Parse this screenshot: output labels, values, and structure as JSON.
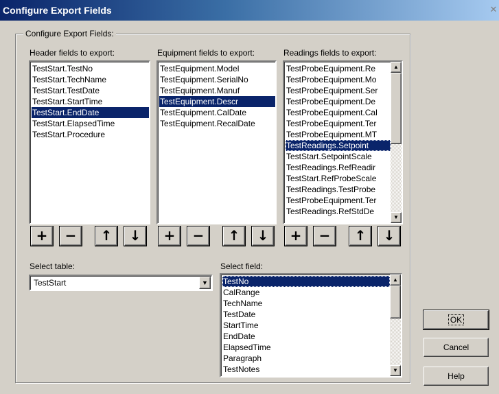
{
  "window": {
    "title": "Configure Export Fields",
    "close_glyph": "✕"
  },
  "group": {
    "label": "Configure Export Fields:"
  },
  "header_fields": {
    "label": "Header fields to export:",
    "items": [
      "TestStart.TestNo",
      "TestStart.TechName",
      "TestStart.TestDate",
      "TestStart.StartTime",
      "TestStart.EndDate",
      "TestStart.ElapsedTime",
      "TestStart.Procedure"
    ],
    "selected_index": 4
  },
  "equipment_fields": {
    "label": "Equipment fields to export:",
    "items": [
      "TestEquipment.Model",
      "TestEquipment.SerialNo",
      "TestEquipment.Manuf",
      "TestEquipment.Descr",
      "TestEquipment.CalDate",
      "TestEquipment.RecalDate"
    ],
    "selected_index": 3
  },
  "readings_fields": {
    "label": "Readings fields to export:",
    "items": [
      "TestProbeEquipment.Re",
      "TestProbeEquipment.Mo",
      "TestProbeEquipment.Ser",
      "TestProbeEquipment.De",
      "TestProbeEquipment.Cal",
      "TestProbeEquipment.Ter",
      "TestProbeEquipment.MT",
      "TestReadings.Setpoint",
      "TestStart.SetpointScale",
      "TestReadings.RefReadir",
      "TestStart.RefProbeScale",
      "TestReadings.TestProbe",
      "TestProbeEquipment.Ter",
      "TestReadings.RefStdDe"
    ],
    "selected_index": 7
  },
  "tool_buttons": {
    "add": "+",
    "remove": "−",
    "up": "↑",
    "down": "↓"
  },
  "select_table": {
    "label": "Select table:",
    "value": "TestStart"
  },
  "select_field": {
    "label": "Select field:",
    "items": [
      "TestNo",
      "CalRange",
      "TechName",
      "TestDate",
      "StartTime",
      "EndDate",
      "ElapsedTime",
      "Paragraph",
      "TestNotes"
    ],
    "selected_index": 0
  },
  "scroll_glyphs": {
    "up": "▲",
    "down": "▼"
  },
  "buttons": {
    "ok": "OK",
    "cancel": "Cancel",
    "help": "Help"
  }
}
